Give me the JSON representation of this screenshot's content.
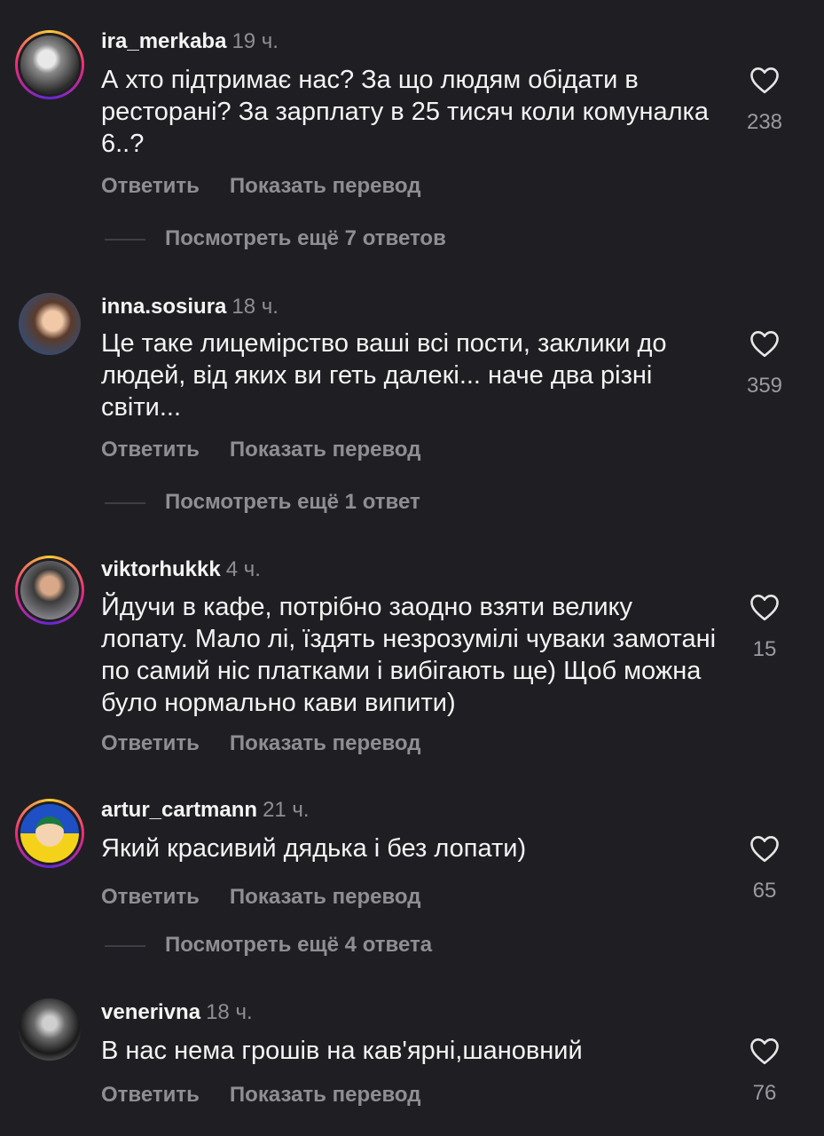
{
  "actions": {
    "reply": "Ответить",
    "translate": "Показать перевод"
  },
  "comments": [
    {
      "user": "ira_merkaba",
      "time": "19 ч.",
      "text": "А хто підтримає нас? За що людям обідати в ресторані? За зарплату в 25 тисяч коли комуналка 6..?",
      "likes": "238",
      "replies": "Посмотреть ещё 7 ответов"
    },
    {
      "user": "inna.sosiura",
      "time": "18 ч.",
      "text": "Це таке лицемірство ваші всі пости, заклики до людей, від яких ви геть далекі... наче два різні світи...",
      "likes": "359",
      "replies": "Посмотреть ещё 1 ответ"
    },
    {
      "user": "viktorhukkk",
      "time": "4 ч.",
      "text": "Йдучи в кафе, потрібно заодно взяти велику лопату. Мало лі, їздять незрозумілі чуваки замотані по самий ніс платками і вибігають ще) Щоб можна було нормально кави випити)",
      "likes": "15"
    },
    {
      "user": "artur_cartmann",
      "time": "21 ч.",
      "text": "Який красивий дядька і без лопати)",
      "likes": "65",
      "replies": "Посмотреть ещё 4 ответа"
    },
    {
      "user": "venerivna",
      "time": "18 ч.",
      "text": "В нас нема грошів на кав'ярні,шановний",
      "likes": "76"
    }
  ]
}
